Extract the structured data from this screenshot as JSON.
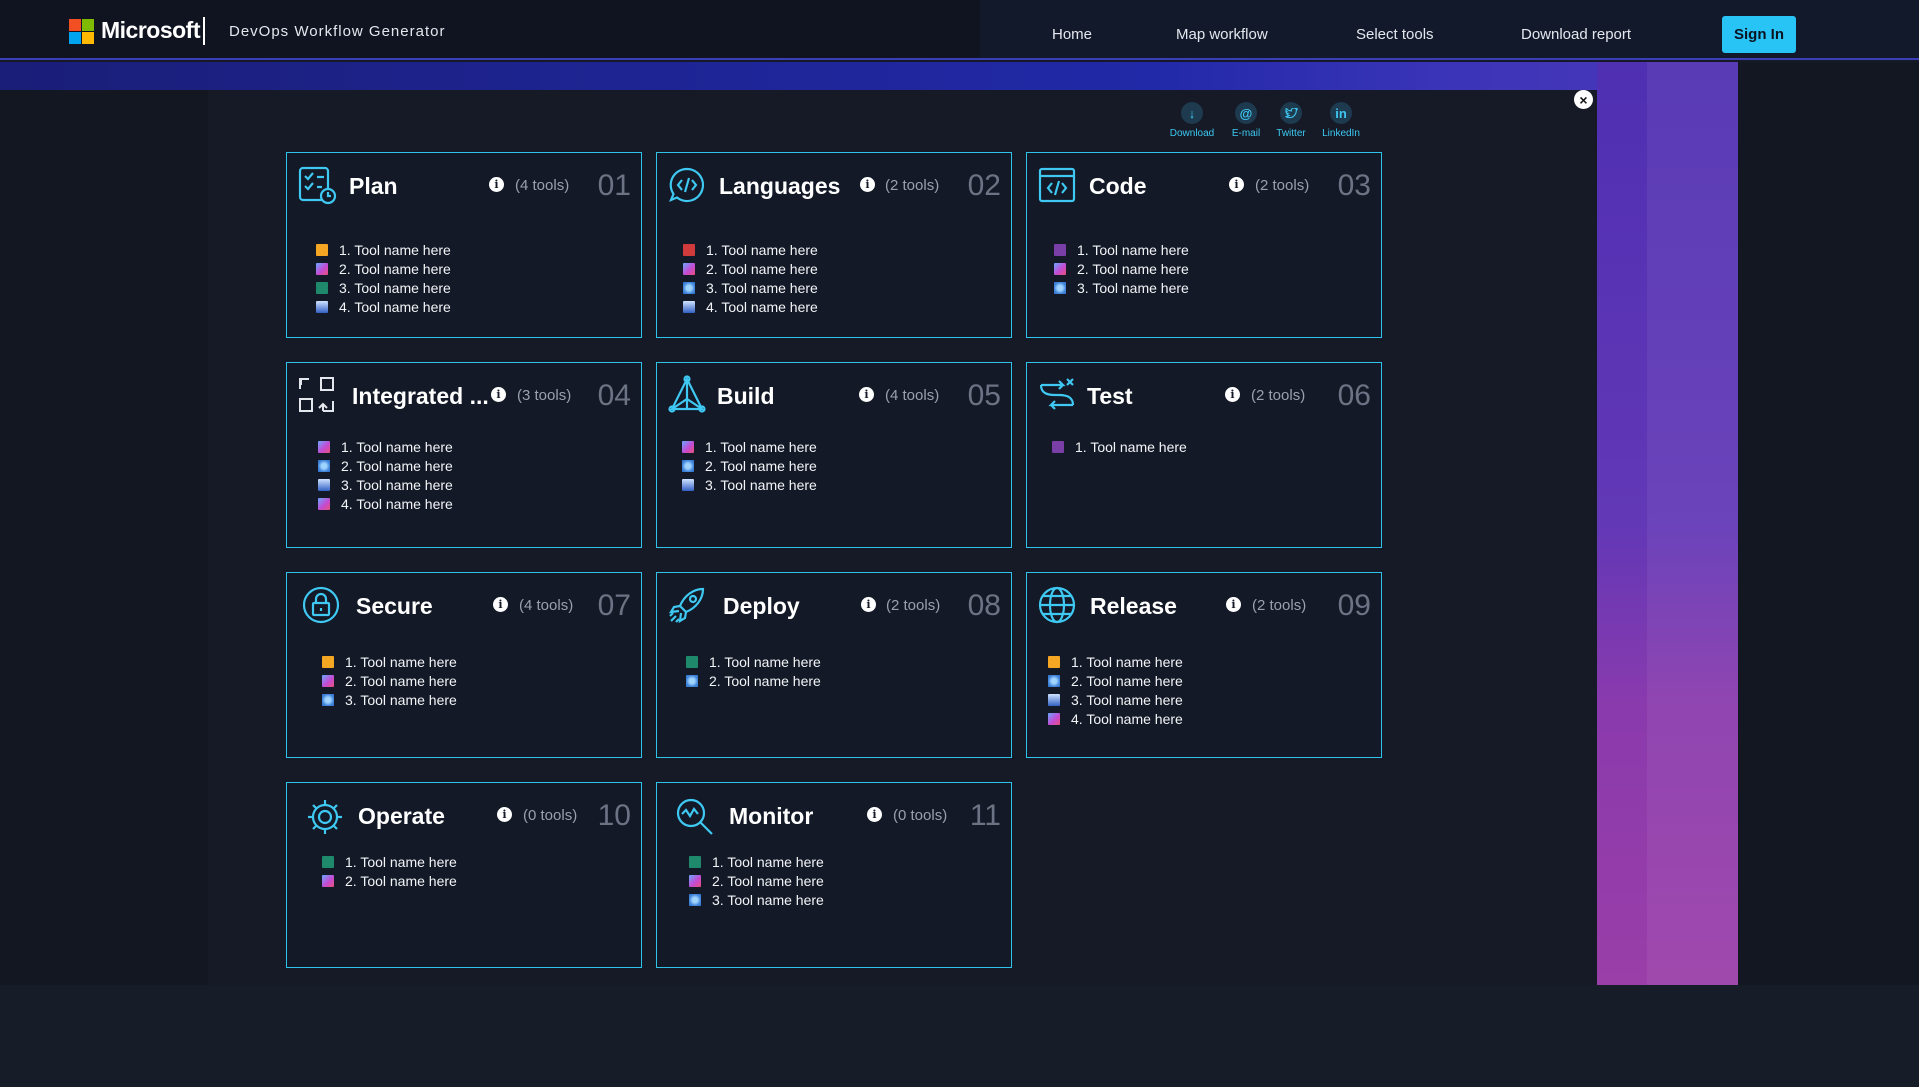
{
  "header": {
    "brand": "Microsoft",
    "app_title": "DevOps Workflow Generator",
    "nav": [
      "Home",
      "Map workflow",
      "Select tools",
      "Download report"
    ],
    "sign_in": "Sign In"
  },
  "share": [
    {
      "label": "Download",
      "icon": "download-icon"
    },
    {
      "label": "E-mail",
      "icon": "email-icon"
    },
    {
      "label": "Twitter",
      "icon": "twitter-icon"
    },
    {
      "label": "LinkedIn",
      "icon": "linkedin-icon"
    }
  ],
  "close_label": "×",
  "info_glyph": "i",
  "cards": [
    {
      "title": "Plan",
      "count": "(4 tools)",
      "number": "01",
      "icon": "plan-checklist-icon",
      "tools": [
        "1. Tool name here",
        "2. Tool name here",
        "3. Tool name here",
        "4. Tool name here"
      ]
    },
    {
      "title": "Languages",
      "count": "(2 tools)",
      "number": "02",
      "icon": "code-chat-icon",
      "tools": [
        "1. Tool name here",
        "2. Tool name here",
        "3. Tool name here",
        "4. Tool name here"
      ]
    },
    {
      "title": "Code",
      "count": "(2 tools)",
      "number": "03",
      "icon": "code-window-icon",
      "tools": [
        "1. Tool name here",
        "2. Tool name here",
        "3. Tool name here"
      ]
    },
    {
      "title": "Integrated ...",
      "count": "(3 tools)",
      "number": "04",
      "icon": "integration-squares-icon",
      "tools": [
        "1. Tool name here",
        "2. Tool name here",
        "3. Tool name here",
        "4. Tool name here"
      ]
    },
    {
      "title": "Build",
      "count": "(4 tools)",
      "number": "05",
      "icon": "build-network-icon",
      "tools": [
        "1. Tool name here",
        "2. Tool name here",
        "3. Tool name here"
      ]
    },
    {
      "title": "Test",
      "count": "(2 tools)",
      "number": "06",
      "icon": "test-flow-icon",
      "tools": [
        "1. Tool name here"
      ]
    },
    {
      "title": "Secure",
      "count": "(4 tools)",
      "number": "07",
      "icon": "lock-icon",
      "tools": [
        "1. Tool name here",
        "2. Tool name here",
        "3. Tool name here"
      ]
    },
    {
      "title": "Deploy",
      "count": "(2 tools)",
      "number": "08",
      "icon": "rocket-icon",
      "tools": [
        "1. Tool name here",
        "2. Tool name here"
      ]
    },
    {
      "title": "Release",
      "count": "(2 tools)",
      "number": "09",
      "icon": "globe-icon",
      "tools": [
        "1. Tool name here",
        "2. Tool name here",
        "3. Tool name here",
        "4. Tool name here"
      ]
    },
    {
      "title": "Operate",
      "count": "(0 tools)",
      "number": "10",
      "icon": "gear-icon",
      "tools": [
        "1. Tool name here",
        "2. Tool name here"
      ]
    },
    {
      "title": "Monitor",
      "count": "(0 tools)",
      "number": "11",
      "icon": "monitor-search-icon",
      "tools": [
        "1. Tool name here",
        "2. Tool name here",
        "3. Tool name here"
      ]
    }
  ],
  "colors": {
    "accent": "#29c4f6",
    "card_border": "#2fc2ea",
    "background": "#151a26"
  }
}
